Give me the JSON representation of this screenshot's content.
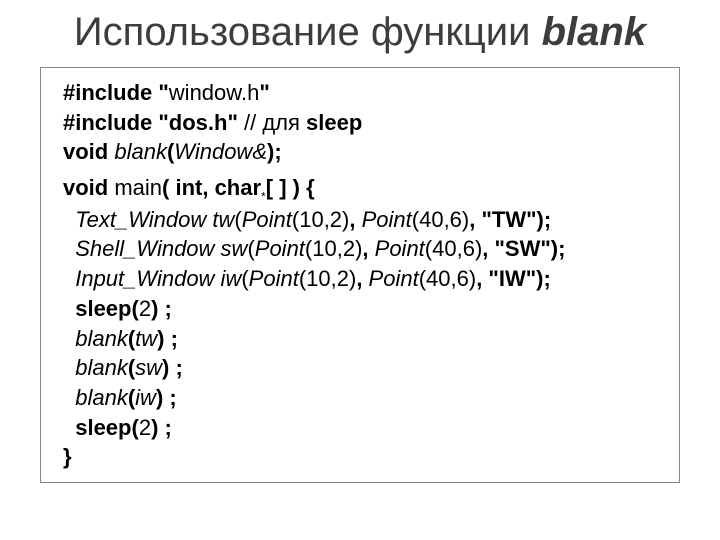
{
  "title": {
    "prefix": "Использование функции ",
    "blank": "blank"
  },
  "code": {
    "l1": {
      "a": "#include \"",
      "b": "window.h",
      "c": "\""
    },
    "l2": {
      "a": "#include \"dos.h\" ",
      "b": "// для ",
      "c": "sleep"
    },
    "l3": {
      "a": "void ",
      "b": "blank",
      "c": "(",
      "d": "Window&",
      "e": ");"
    },
    "l4": {
      "a": "void ",
      "b": "main",
      "c": "( int, char",
      "d": "*",
      "e": "[ ] ) {"
    },
    "l5": {
      "a": "  Text_Window tw",
      "b": "(",
      "c": "Point",
      "d": "(10,2)",
      "e": ", ",
      "f": "Point",
      "g": "(40,6)",
      "h": ", \"TW\");"
    },
    "l6": {
      "a": "  Shell_Window sw",
      "b": "(",
      "c": "Point",
      "d": "(10,2)",
      "e": ", ",
      "f": "Point",
      "g": "(40,6)",
      "h": ", \"SW\");"
    },
    "l7": {
      "a": "  Input_Window iw",
      "b": "(",
      "c": "Point",
      "d": "(10,2)",
      "e": ", ",
      "f": "Point",
      "g": "(40,6)",
      "h": ", \"IW\");"
    },
    "l8": {
      "a": "  sleep(",
      "b": "2",
      "c": ") ;"
    },
    "l9": {
      "a": "  blank",
      "b": "(",
      "c": "tw",
      "d": ") ;"
    },
    "l10": {
      "a": "  blank",
      "b": "(",
      "c": "sw",
      "d": ") ;"
    },
    "l11": {
      "a": "  blank",
      "b": "(",
      "c": "iw",
      "d": ") ;"
    },
    "l12": {
      "a": "  sleep(",
      "b": "2",
      "c": ") ;"
    },
    "l13": {
      "a": "}"
    }
  }
}
